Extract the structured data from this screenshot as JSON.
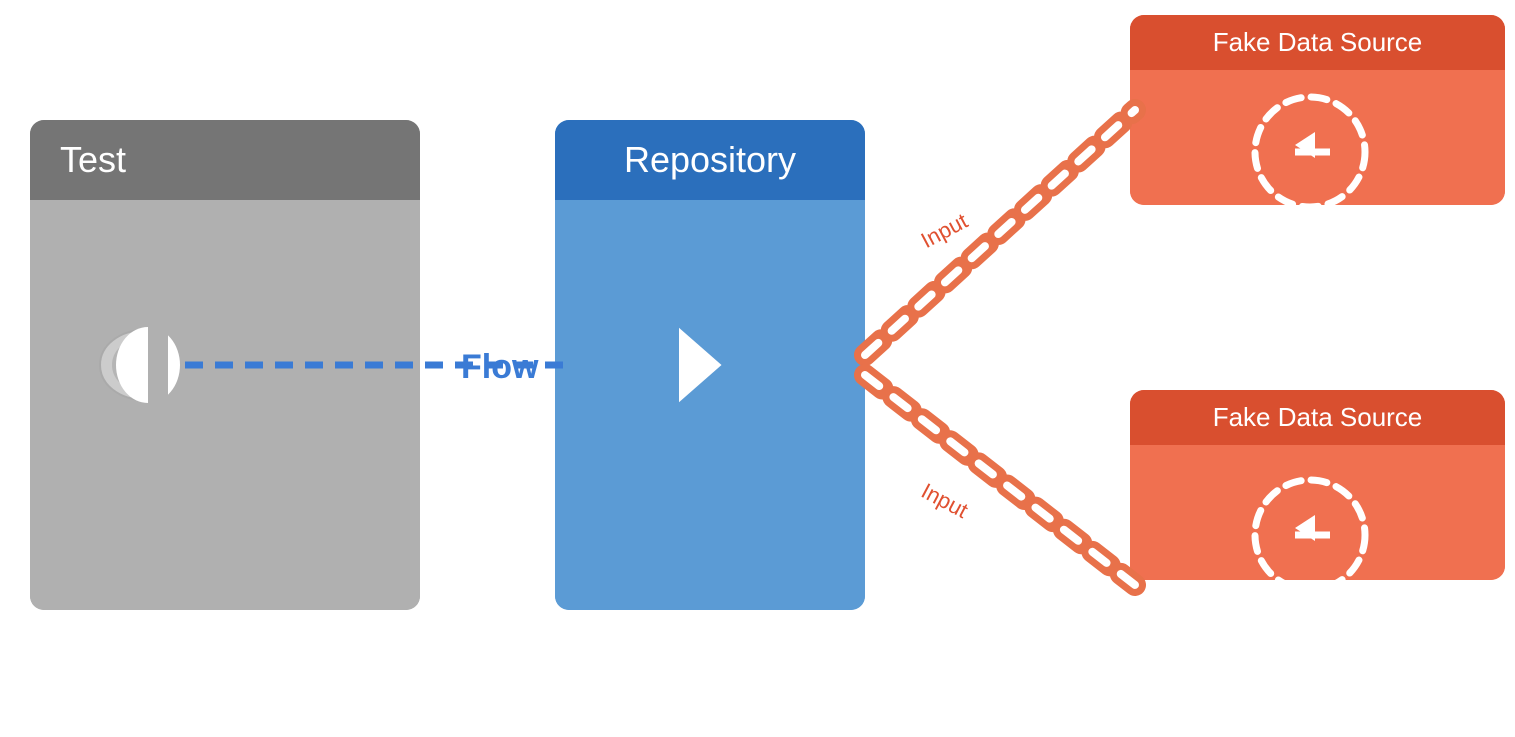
{
  "blocks": {
    "test": {
      "label": "Test"
    },
    "repository": {
      "label": "Repository"
    },
    "fakeDataSource1": {
      "label": "Fake Data Source"
    },
    "fakeDataSource2": {
      "label": "Fake Data Source"
    }
  },
  "connections": {
    "flow_label": "Flow",
    "input_label_top": "Input",
    "input_label_bottom": "Input"
  },
  "colors": {
    "test_header": "#757575",
    "test_body": "#b0b0b0",
    "repo_header": "#2b6fbc",
    "repo_body": "#5b9bd5",
    "fds_header": "#d94f2f",
    "fds_body": "#f07050",
    "flow_line": "#3a7bd5",
    "input_line": "#e8714a",
    "white": "#ffffff"
  }
}
